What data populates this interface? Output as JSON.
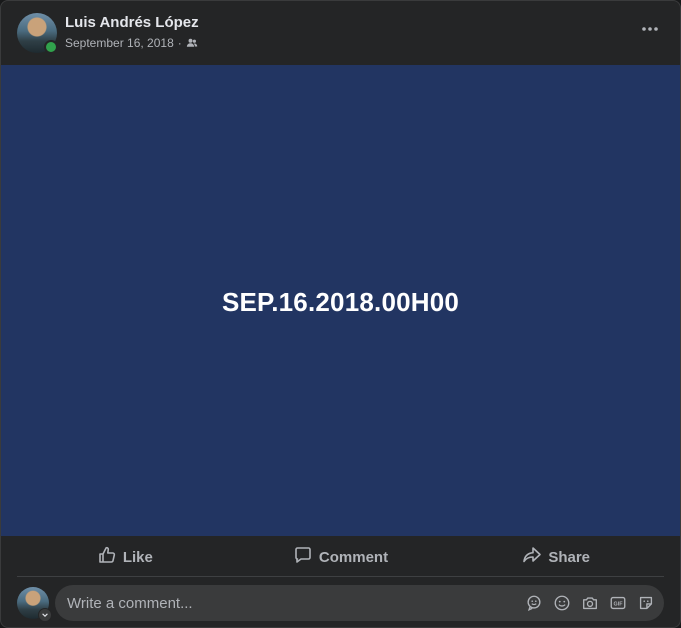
{
  "post": {
    "author": "Luis Andrés López",
    "date": "September 16, 2018",
    "separator": "·",
    "audience_icon": "friends-icon",
    "more_icon": "more-horizontal-icon",
    "body_text": "SEP.16.2018.00H00",
    "background_color": "#223562"
  },
  "actions": {
    "like_label": "Like",
    "like_icon": "thumbs-up-icon",
    "comment_label": "Comment",
    "comment_icon": "speech-bubble-icon",
    "share_label": "Share",
    "share_icon": "share-arrow-icon"
  },
  "comment": {
    "placeholder": "Write a comment...",
    "icons": [
      "avatar-sticker-icon",
      "emoji-icon",
      "camera-icon",
      "gif-icon",
      "sticker-icon"
    ]
  },
  "colors": {
    "card_bg": "#242526",
    "text_primary": "#e4e6eb",
    "text_secondary": "#b0b3b8",
    "online": "#31a24c"
  }
}
